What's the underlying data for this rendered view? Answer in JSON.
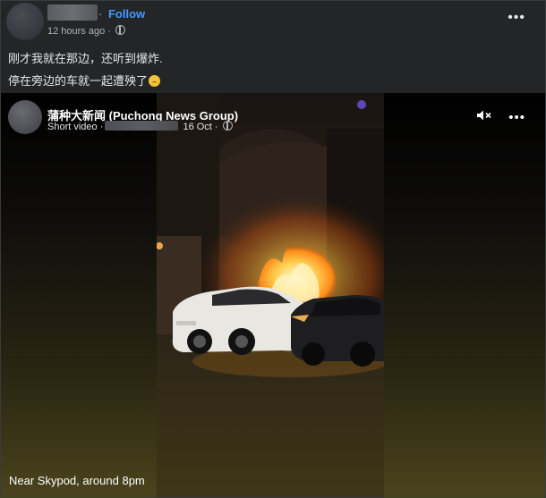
{
  "post": {
    "follow_label": "Follow",
    "time": "12 hours ago",
    "text_lines": [
      "刚才我就在那边，还听到爆炸.",
      "停在旁边的车就一起遭殃了"
    ],
    "more_icon": "more-horizontal-icon"
  },
  "video": {
    "page_name": "蒲种大新闻 (Puchong News Group)",
    "type_label": "Short video",
    "date": "16 Oct",
    "caption": "Near Skypod, around 8pm",
    "mute_icon": "speaker-muted-icon",
    "more_icon": "more-horizontal-icon"
  },
  "colors": {
    "accent": "#4599ff",
    "background": "#242526",
    "fire": "#ff9d1a"
  }
}
